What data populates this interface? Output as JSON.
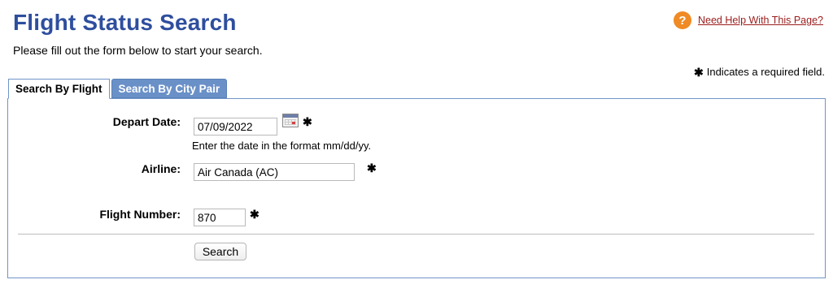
{
  "page": {
    "title": "Flight Status Search",
    "subtitle": "Please fill out the form below to start your search."
  },
  "help": {
    "icon_glyph": "?",
    "link_text": "Need Help With This Page?",
    "icon": "question-circle-icon",
    "color": "#ef8a25"
  },
  "required_note": {
    "symbol": "✱",
    "text": "Indicates a required field."
  },
  "tabs": [
    {
      "label": "Search By Flight",
      "active": true
    },
    {
      "label": "Search By City Pair",
      "active": false
    }
  ],
  "form": {
    "depart_date": {
      "label": "Depart Date:",
      "value": "07/09/2022",
      "hint": "Enter the date in the format mm/dd/yy.",
      "icon": "calendar-icon"
    },
    "airline": {
      "label": "Airline:",
      "value": "Air Canada (AC)"
    },
    "flight_number": {
      "label": "Flight Number:",
      "value": "870"
    },
    "required_symbol": "✱",
    "search_label": "Search"
  },
  "colors": {
    "title": "#2e4e9e",
    "tab_inactive": "#6a90c8",
    "panel_border": "#6f94c8",
    "help_link": "#9b1c1c"
  }
}
